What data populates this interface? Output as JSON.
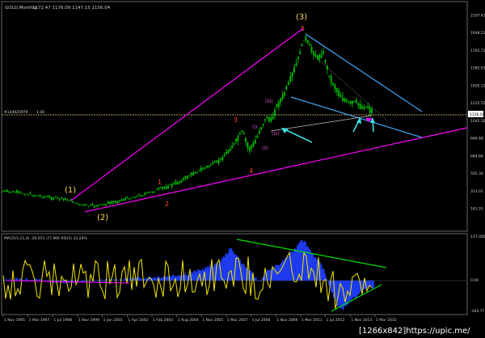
{
  "header": {
    "title": "GOLD,Monthly",
    "ohlc": "1172.47 1176.09 1147.15 1156.04"
  },
  "main_chart": {
    "level_line_label": "#134025979",
    "level_line_label2": "1.00",
    "right_axis": [
      "2107.43",
      "1948.51",
      "1765.71",
      "1585.63",
      "1405.12",
      "1225.55",
      "1045.50",
      "866.48",
      "684.66",
      "505.34",
      "323.01",
      "161.55"
    ],
    "price_tag": "1156.04"
  },
  "wave_labels": {
    "w1": "(1)",
    "w2": "(2)",
    "w3": "(3)",
    "s1": "1",
    "s2": "2",
    "s3": "3",
    "s4": "4",
    "s5": "5",
    "si": "(i)",
    "sii": "(ii)",
    "siii": "(iii)",
    "siv": "(iv)"
  },
  "indicator": {
    "title": "MACD(5,11,4) -28.553 -27.966  RSI(5) 32.24%",
    "right_axis": [
      "137.000",
      "0.00",
      "-164.77"
    ]
  },
  "x_axis": [
    "1 Nov 1995",
    "1 Mar 1997",
    "1 Jul 1998",
    "1 Nov 1999",
    "1 Jan 2001",
    "1 Apr 2002",
    "1 Feb 2003",
    "1 Aug 2004",
    "1 Nov 2005",
    "1 Mar 2007",
    "1 Jul 2008",
    "1 Nov 2009",
    "1 Mar 2011",
    "1 Jul 2012",
    "1 Nov 2013",
    "1 Mar 2015"
  ],
  "watermark": "[1266x842]https://upic.me/",
  "colors": {
    "background": "#000000",
    "candles": "#00c000",
    "trend_magenta": "#ff00ff",
    "trend_blue": "#3fa9f5",
    "macd_histogram": "#1f3fff",
    "rsi_line": "#f2e600",
    "signal_green": "#00e000",
    "wave_orange": "#ffd75a",
    "wave_red": "#ff4a2a",
    "wave_violet": "#d65fd6",
    "arrow_cyan": "#41e0e0"
  }
}
